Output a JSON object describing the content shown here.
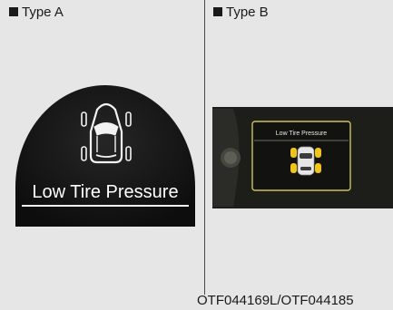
{
  "panels": [
    {
      "label": "Type A",
      "display_text": "Low Tire Pressure"
    },
    {
      "label": "Type B",
      "display_text": "Low Tire Pressure"
    }
  ],
  "caption": "OTF044169L/OTF044185",
  "icons": {
    "panel_a_vehicle": "car-top-view-icon",
    "panel_b_vehicle": "car-top-view-icon",
    "panel_b_knob": "knob-icon"
  },
  "colors": {
    "background": "#e6e6e6",
    "display": "#141414",
    "display_text": "#ffffff",
    "warning": "#f0c419",
    "frame": "#c9c35a"
  }
}
